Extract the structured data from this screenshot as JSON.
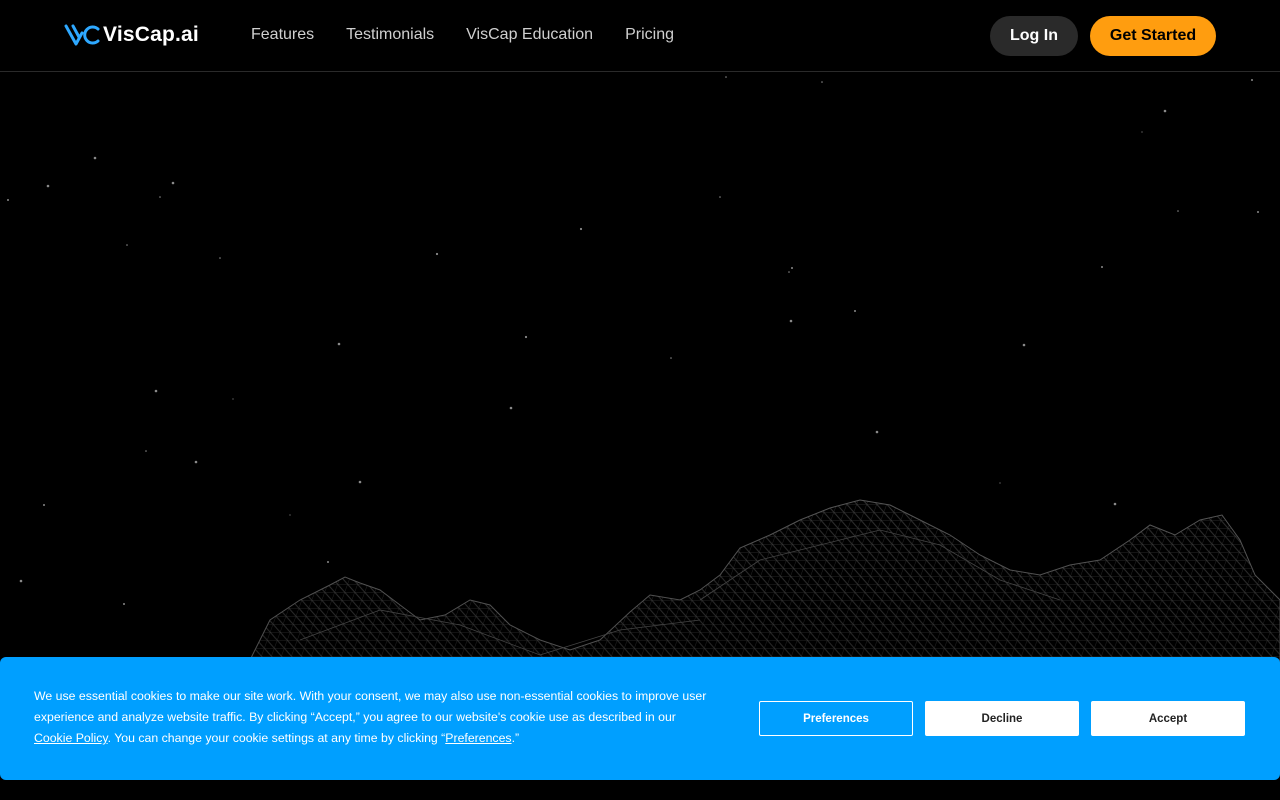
{
  "header": {
    "logo_text": "VisCap.ai",
    "nav": [
      {
        "label": "Features"
      },
      {
        "label": "Testimonials"
      },
      {
        "label": "VisCap Education"
      },
      {
        "label": "Pricing"
      }
    ],
    "login_label": "Log In",
    "get_started_label": "Get Started"
  },
  "cookie": {
    "text_part1": "We use essential cookies to make our site work. With your consent, we may also use non-essential cookies to improve user experience and analyze website traffic. By clicking “Accept,” you agree to our website's cookie use as described in our ",
    "policy_link": "Cookie Policy",
    "text_part2": ". You can change your cookie settings at any time by clicking “",
    "preferences_link": "Preferences",
    "text_part3": ".”",
    "preferences_button": "Preferences",
    "decline_button": "Decline",
    "accept_button": "Accept"
  },
  "colors": {
    "background": "#000000",
    "accent_orange": "#ff9d0f",
    "cookie_blue": "#009fff",
    "logo_blue": "#2ea8ff"
  }
}
